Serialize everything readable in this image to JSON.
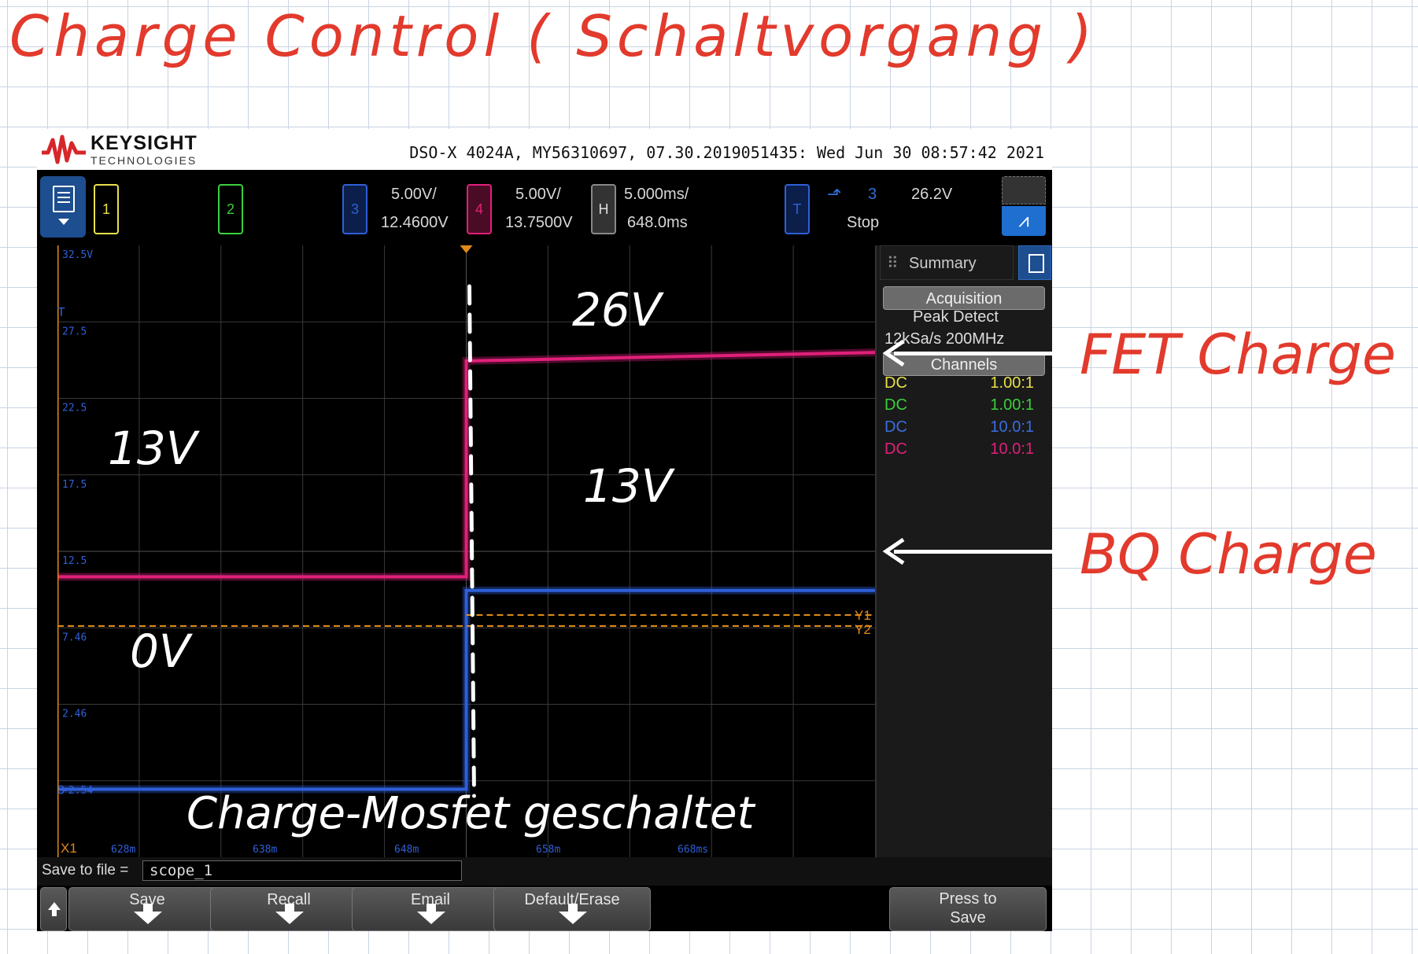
{
  "annotations": {
    "title": "Charge Control ( Schaltvorgang )",
    "fet_charge": "FET Charge",
    "bq_charge": "BQ Charge",
    "v26": "26V",
    "v13_top": "13V",
    "v13_right": "13V",
    "v0": "0V",
    "mosfet": "Charge-Mosfet geschaltet"
  },
  "header": {
    "brand": "KEYSIGHT",
    "brand_sub": "TECHNOLOGIES",
    "device_info": "DSO-X 4024A, MY56310697, 07.30.2019051435: Wed Jun 30 08:57:42 2021"
  },
  "channels": {
    "ch1_label": "1",
    "ch2_label": "2",
    "ch3_label": "3",
    "ch3_scale": "5.00V/",
    "ch3_offset": "12.4600V",
    "ch4_label": "4",
    "ch4_scale": "5.00V/",
    "ch4_offset": "13.7500V",
    "h_label": "H",
    "h_scale": "5.000ms/",
    "h_delay": "648.0ms",
    "t_label": "T",
    "trig_source": "3",
    "trig_level": "26.2V",
    "run_state": "Stop"
  },
  "colors": {
    "ch1": "#e8e04a",
    "ch2": "#3ccf3c",
    "ch3": "#2f5fd8",
    "ch4": "#e0207a",
    "cursor": "#e08a1a",
    "annotation_red": "#e23a2c"
  },
  "grid_labels": {
    "y": [
      "32.5V",
      "27.5",
      "22.5",
      "17.5",
      "12.5",
      "7.46",
      "2.46",
      "-2.54"
    ],
    "x": [
      "628m",
      "638m",
      "648m",
      "658m",
      "668ms"
    ],
    "y1": "Y1",
    "y2": "Y2",
    "x1": "X1",
    "ch3_marker": "3",
    "t_marker": "T"
  },
  "summary": {
    "tab": "Summary",
    "acquisition": "Acquisition",
    "mode": "Peak Detect",
    "rate": "12kSa/s 200MHz",
    "channels_header": "Channels",
    "rows": [
      {
        "coupling": "DC",
        "probe": "1.00:1"
      },
      {
        "coupling": "DC",
        "probe": "1.00:1"
      },
      {
        "coupling": "DC",
        "probe": "10.0:1"
      },
      {
        "coupling": "DC",
        "probe": "10.0:1"
      }
    ]
  },
  "file": {
    "label": "Save to file =",
    "value": "scope_1"
  },
  "softkeys": {
    "save": "Save",
    "recall": "Recall",
    "email": "Email",
    "default_erase": "Default/Erase",
    "press_to": "Press to",
    "save2": "Save"
  },
  "chart_data": {
    "type": "line",
    "title": "",
    "xlabel": "",
    "ylabel": "",
    "x_unit": "ms",
    "xlim": [
      625.5,
      670.5
    ],
    "ylim": [
      -3.5,
      32.5
    ],
    "series": [
      {
        "name": "",
        "color": "#e0207a",
        "x": [
          625.5,
          648.0,
          648.0,
          670.5
        ],
        "y": [
          13.0,
          13.0,
          25.7,
          26.2
        ]
      },
      {
        "name": "",
        "color": "#2f5fd8",
        "x": [
          625.5,
          648.0,
          648.0,
          670.5
        ],
        "y": [
          0.5,
          0.5,
          12.2,
          12.2
        ]
      }
    ]
  }
}
